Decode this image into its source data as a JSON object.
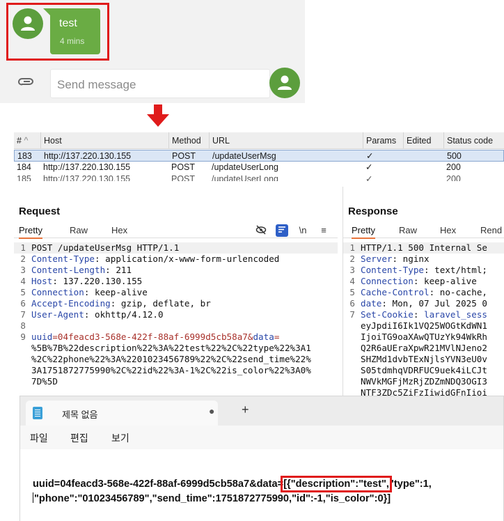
{
  "chat": {
    "message_text": "test",
    "message_time": "4 mins",
    "input_placeholder": "Send message",
    "icons": {
      "avatar": "user-avatar-icon",
      "attach": "paperclip-icon",
      "send_avatar": "user-avatar-icon"
    }
  },
  "history": {
    "columns": [
      "#",
      "Host",
      "Method",
      "URL",
      "Params",
      "Edited",
      "Status code"
    ],
    "rows": [
      {
        "num": "183",
        "host": "http://137.220.130.155",
        "method": "POST",
        "url": "/updateUserMsg",
        "params": "✓",
        "edited": "",
        "status": "500"
      },
      {
        "num": "184",
        "host": "http://137.220.130.155",
        "method": "POST",
        "url": "/updateUserLong",
        "params": "✓",
        "edited": "",
        "status": "200"
      },
      {
        "num": "185",
        "host": "http://137.220.130.155",
        "method": "POST",
        "url": "/updateUserLong",
        "params": "✓",
        "edited": "",
        "status": "200"
      }
    ]
  },
  "request": {
    "title": "Request",
    "tabs": [
      "Pretty",
      "Raw",
      "Hex"
    ],
    "toolbar": {
      "wrap": "\\n",
      "menu": "≡"
    },
    "lines": [
      {
        "n": "1",
        "text": "POST /updateUserMsg HTTP/1.1"
      },
      {
        "n": "2",
        "key": "Content-Type",
        "val": " application/x-www-form-urlencoded"
      },
      {
        "n": "3",
        "key": "Content-Length",
        "val": " 211"
      },
      {
        "n": "4",
        "key": "Host",
        "val": " 137.220.130.155"
      },
      {
        "n": "5",
        "key": "Connection",
        "val": " keep-alive"
      },
      {
        "n": "6",
        "key": "Accept-Encoding",
        "val": " gzip, deflate, br"
      },
      {
        "n": "7",
        "key": "User-Agent",
        "val": " okhttp/4.12.0"
      },
      {
        "n": "8",
        "text": ""
      },
      {
        "n": "9",
        "body1a": "uuid",
        "body1b": "=04feacd3-568e-422f-88af-6999d5cb58a7&",
        "body1c": "data",
        "body1d": "="
      },
      {
        "n": "",
        "body": "%5B%7B%22description%22%3A%22test%22%2C%22type%22%3A1"
      },
      {
        "n": "",
        "body": "%2C%22phone%22%3A%2201023456789%22%2C%22send_time%22%"
      },
      {
        "n": "",
        "body": "3A1751872775990%2C%22id%22%3A-1%2C%22is_color%22%3A0%"
      },
      {
        "n": "",
        "body": "7D%5D"
      }
    ]
  },
  "response": {
    "title": "Response",
    "tabs": [
      "Pretty",
      "Raw",
      "Hex",
      "Rend"
    ],
    "lines": [
      {
        "n": "1",
        "text": "HTTP/1.1 500 Internal Se"
      },
      {
        "n": "2",
        "key": "Server",
        "val": " nginx"
      },
      {
        "n": "3",
        "key": "Content-Type",
        "val": " text/html;"
      },
      {
        "n": "4",
        "key": "Connection",
        "val": " keep-alive"
      },
      {
        "n": "5",
        "key": "Cache-Control",
        "val": " no-cache,"
      },
      {
        "n": "6",
        "key": "date",
        "val": " Mon, 07 Jul 2025 0"
      },
      {
        "n": "7",
        "key": "Set-Cookie",
        "val": " laravel_sess"
      },
      {
        "n": "",
        "body": "eyJpdiI6Ik1VQ25WOGtKdWN1"
      },
      {
        "n": "",
        "body": "IjoiTG9oaXAwQTUzYk94WkRh"
      },
      {
        "n": "",
        "body": "Q2R6aUEraXpwR21MVlNJeno2"
      },
      {
        "n": "",
        "body": "SHZMd1dvbTExNjlsYVN3eU0v"
      },
      {
        "n": "",
        "body": "S05tdmhqVDRFUC9uek4iLCJt"
      },
      {
        "n": "",
        "body": "NWVkMGFjMzRjZDZmNDQ3OGI3"
      },
      {
        "n": "",
        "body": "NTF3ZDc5ZiFzIiwidGFnIioi"
      }
    ]
  },
  "notepad": {
    "tab_title": "제목 없음",
    "tab_dot": "●",
    "new_tab": "+",
    "menu": [
      "파일",
      "편집",
      "보기"
    ],
    "text_part1": "uuid=04feacd3-568e-422f-88af-6999d5cb58a7&data=",
    "text_highlight": "[{\"description\":\"test\",",
    "text_part2": "\"type\":1,",
    "text_line2": "\"phone\":\"01023456789\",\"send_time\":1751872775990,\"id\":-1,\"is_color\":0}]"
  },
  "colors": {
    "chat_green": "#6aac44",
    "highlight_red": "#e01b1b",
    "selected_row": "#dbe6f5",
    "header_key": "#2a47a8",
    "body_value": "#a8302a"
  }
}
